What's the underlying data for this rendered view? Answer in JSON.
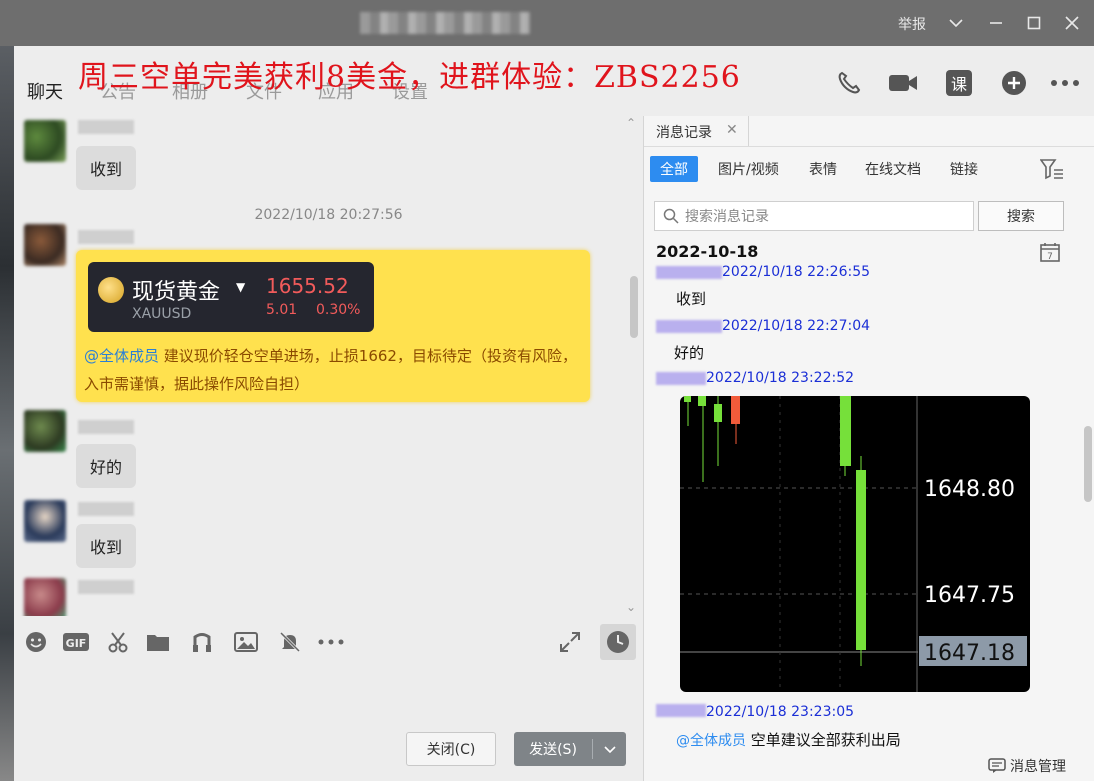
{
  "window": {
    "report_label": "举报"
  },
  "tabs": [
    {
      "label": "聊天"
    },
    {
      "label": "公告"
    },
    {
      "label": "相册"
    },
    {
      "label": "文件"
    },
    {
      "label": "应用"
    },
    {
      "label": "设置"
    }
  ],
  "promo_text": "周三空单完美获利8美金，进群体验：ZBS2256",
  "top_icons": {
    "course_label": "课"
  },
  "chat": {
    "messages": [
      {
        "text": "收到"
      },
      {
        "text": "好的"
      },
      {
        "text": "收到"
      }
    ],
    "timestamp": "2022/10/18 20:27:56",
    "card": {
      "name": "现货黄金",
      "symbol": "XAUUSD",
      "price": "1655.52",
      "change": "5.01",
      "change_pct": "0.30%",
      "mention": "@全体成员",
      "text": "建议现价轻仓空单进场，止损1662，目标待定（投资有风险，入市需谨慎，据此操作风险自担）"
    }
  },
  "buttons": {
    "close": "关闭(C)",
    "send": "发送(S)"
  },
  "panel": {
    "tab_title": "消息记录",
    "filters": [
      "全部",
      "图片/视频",
      "表情",
      "在线文档",
      "链接"
    ],
    "search_placeholder": "搜索消息记录",
    "search_button": "搜索",
    "date_header": "2022-10-18",
    "logs": [
      {
        "time": "2022/10/18 22:26:55",
        "msg": "收到"
      },
      {
        "time": "2022/10/18 22:27:04",
        "msg": "好的"
      },
      {
        "time": "2022/10/18 23:22:52",
        "msg": ""
      },
      {
        "time": "2022/10/18 23:23:05",
        "mention": "@全体成员",
        "msg": "空单建议全部获利出局"
      }
    ],
    "chart_labels": [
      "1648.80",
      "1647.75",
      "1647.18"
    ],
    "bottom_tool_label": "消息管理"
  },
  "colors": {
    "accent": "#2d8cf0",
    "promo": "#e0141c",
    "card_bg": "#ffe14e",
    "log_time": "#1b2fd6",
    "up_candle": "#76e03a",
    "down_candle": "#f25b3a"
  }
}
